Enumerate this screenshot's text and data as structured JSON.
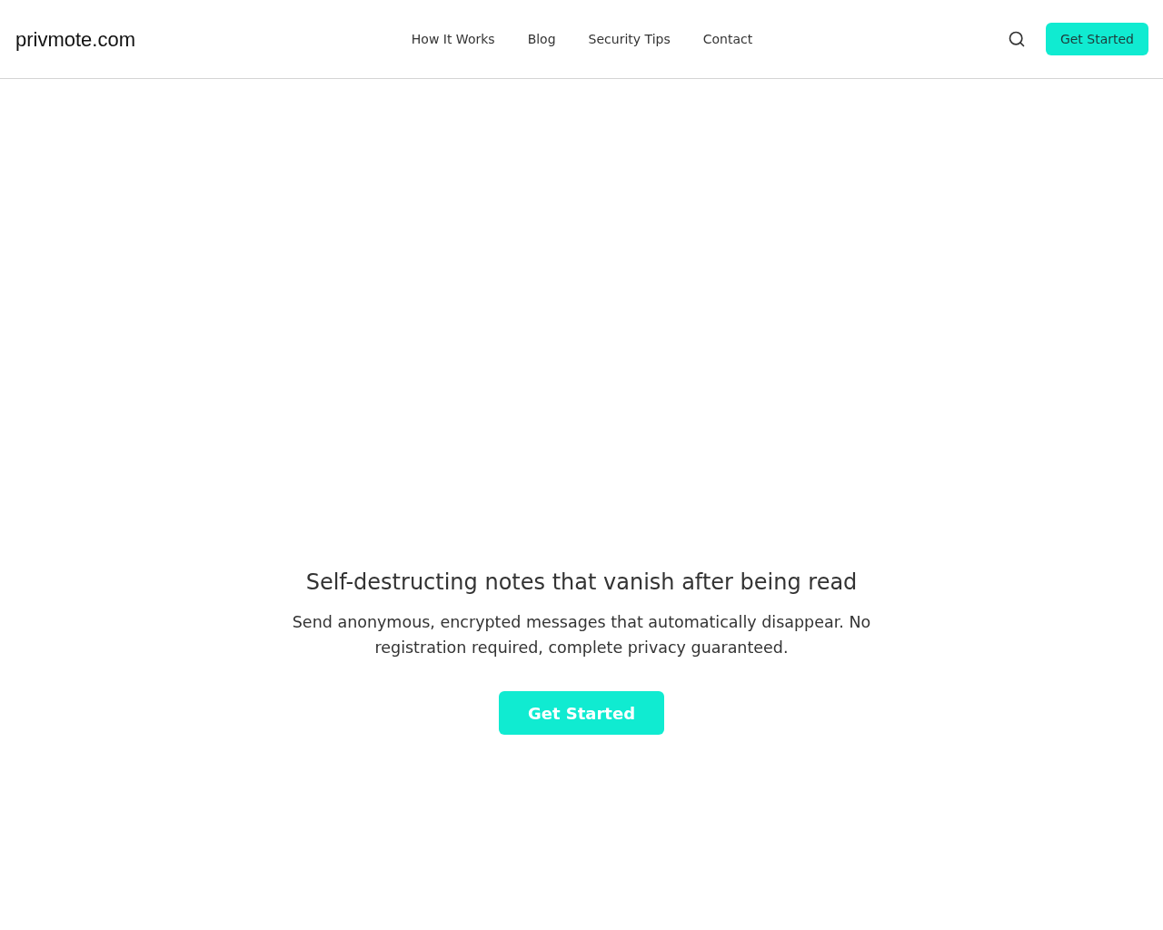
{
  "header": {
    "logo": "privmote.com",
    "nav": [
      "How It Works",
      "Blog",
      "Security Tips",
      "Contact"
    ],
    "button": "Get Started"
  },
  "hero": {
    "title": "Self-destructing notes that vanish after being read",
    "subtitle": "Send anonymous, encrypted messages that automatically disappear. No registration required, complete privacy guaranteed.",
    "button": "Get Started"
  }
}
